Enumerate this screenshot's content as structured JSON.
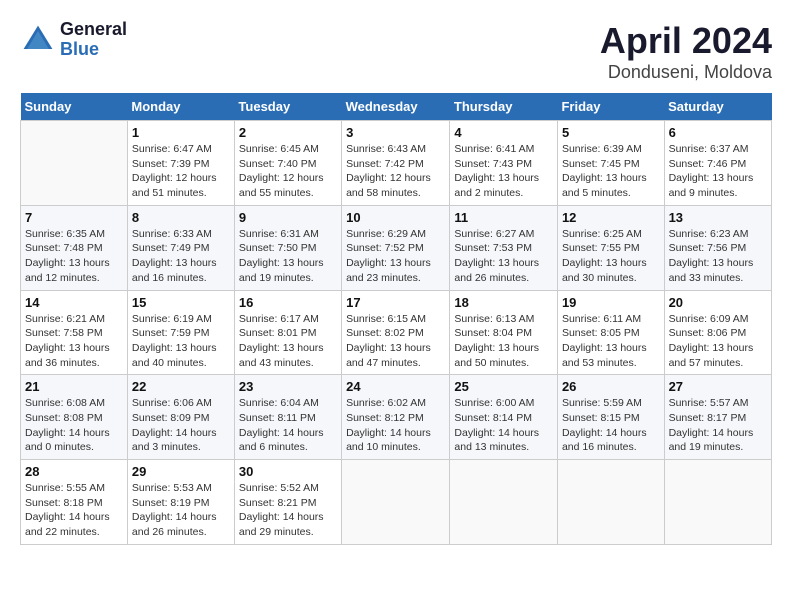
{
  "header": {
    "logo_general": "General",
    "logo_blue": "Blue",
    "title": "April 2024",
    "subtitle": "Donduseni, Moldova"
  },
  "days_of_week": [
    "Sunday",
    "Monday",
    "Tuesday",
    "Wednesday",
    "Thursday",
    "Friday",
    "Saturday"
  ],
  "weeks": [
    [
      {
        "day": "",
        "info": ""
      },
      {
        "day": "1",
        "info": "Sunrise: 6:47 AM\nSunset: 7:39 PM\nDaylight: 12 hours\nand 51 minutes."
      },
      {
        "day": "2",
        "info": "Sunrise: 6:45 AM\nSunset: 7:40 PM\nDaylight: 12 hours\nand 55 minutes."
      },
      {
        "day": "3",
        "info": "Sunrise: 6:43 AM\nSunset: 7:42 PM\nDaylight: 12 hours\nand 58 minutes."
      },
      {
        "day": "4",
        "info": "Sunrise: 6:41 AM\nSunset: 7:43 PM\nDaylight: 13 hours\nand 2 minutes."
      },
      {
        "day": "5",
        "info": "Sunrise: 6:39 AM\nSunset: 7:45 PM\nDaylight: 13 hours\nand 5 minutes."
      },
      {
        "day": "6",
        "info": "Sunrise: 6:37 AM\nSunset: 7:46 PM\nDaylight: 13 hours\nand 9 minutes."
      }
    ],
    [
      {
        "day": "7",
        "info": "Sunrise: 6:35 AM\nSunset: 7:48 PM\nDaylight: 13 hours\nand 12 minutes."
      },
      {
        "day": "8",
        "info": "Sunrise: 6:33 AM\nSunset: 7:49 PM\nDaylight: 13 hours\nand 16 minutes."
      },
      {
        "day": "9",
        "info": "Sunrise: 6:31 AM\nSunset: 7:50 PM\nDaylight: 13 hours\nand 19 minutes."
      },
      {
        "day": "10",
        "info": "Sunrise: 6:29 AM\nSunset: 7:52 PM\nDaylight: 13 hours\nand 23 minutes."
      },
      {
        "day": "11",
        "info": "Sunrise: 6:27 AM\nSunset: 7:53 PM\nDaylight: 13 hours\nand 26 minutes."
      },
      {
        "day": "12",
        "info": "Sunrise: 6:25 AM\nSunset: 7:55 PM\nDaylight: 13 hours\nand 30 minutes."
      },
      {
        "day": "13",
        "info": "Sunrise: 6:23 AM\nSunset: 7:56 PM\nDaylight: 13 hours\nand 33 minutes."
      }
    ],
    [
      {
        "day": "14",
        "info": "Sunrise: 6:21 AM\nSunset: 7:58 PM\nDaylight: 13 hours\nand 36 minutes."
      },
      {
        "day": "15",
        "info": "Sunrise: 6:19 AM\nSunset: 7:59 PM\nDaylight: 13 hours\nand 40 minutes."
      },
      {
        "day": "16",
        "info": "Sunrise: 6:17 AM\nSunset: 8:01 PM\nDaylight: 13 hours\nand 43 minutes."
      },
      {
        "day": "17",
        "info": "Sunrise: 6:15 AM\nSunset: 8:02 PM\nDaylight: 13 hours\nand 47 minutes."
      },
      {
        "day": "18",
        "info": "Sunrise: 6:13 AM\nSunset: 8:04 PM\nDaylight: 13 hours\nand 50 minutes."
      },
      {
        "day": "19",
        "info": "Sunrise: 6:11 AM\nSunset: 8:05 PM\nDaylight: 13 hours\nand 53 minutes."
      },
      {
        "day": "20",
        "info": "Sunrise: 6:09 AM\nSunset: 8:06 PM\nDaylight: 13 hours\nand 57 minutes."
      }
    ],
    [
      {
        "day": "21",
        "info": "Sunrise: 6:08 AM\nSunset: 8:08 PM\nDaylight: 14 hours\nand 0 minutes."
      },
      {
        "day": "22",
        "info": "Sunrise: 6:06 AM\nSunset: 8:09 PM\nDaylight: 14 hours\nand 3 minutes."
      },
      {
        "day": "23",
        "info": "Sunrise: 6:04 AM\nSunset: 8:11 PM\nDaylight: 14 hours\nand 6 minutes."
      },
      {
        "day": "24",
        "info": "Sunrise: 6:02 AM\nSunset: 8:12 PM\nDaylight: 14 hours\nand 10 minutes."
      },
      {
        "day": "25",
        "info": "Sunrise: 6:00 AM\nSunset: 8:14 PM\nDaylight: 14 hours\nand 13 minutes."
      },
      {
        "day": "26",
        "info": "Sunrise: 5:59 AM\nSunset: 8:15 PM\nDaylight: 14 hours\nand 16 minutes."
      },
      {
        "day": "27",
        "info": "Sunrise: 5:57 AM\nSunset: 8:17 PM\nDaylight: 14 hours\nand 19 minutes."
      }
    ],
    [
      {
        "day": "28",
        "info": "Sunrise: 5:55 AM\nSunset: 8:18 PM\nDaylight: 14 hours\nand 22 minutes."
      },
      {
        "day": "29",
        "info": "Sunrise: 5:53 AM\nSunset: 8:19 PM\nDaylight: 14 hours\nand 26 minutes."
      },
      {
        "day": "30",
        "info": "Sunrise: 5:52 AM\nSunset: 8:21 PM\nDaylight: 14 hours\nand 29 minutes."
      },
      {
        "day": "",
        "info": ""
      },
      {
        "day": "",
        "info": ""
      },
      {
        "day": "",
        "info": ""
      },
      {
        "day": "",
        "info": ""
      }
    ]
  ]
}
